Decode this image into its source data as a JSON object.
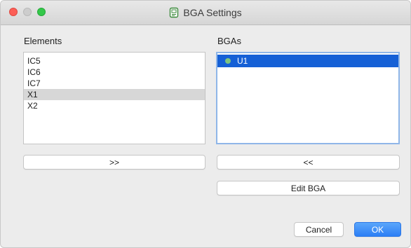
{
  "window": {
    "title": "BGA Settings",
    "icon": "chip-icon"
  },
  "elements_panel": {
    "label": "Elements",
    "items": [
      "IC5",
      "IC6",
      "IC7",
      "X1",
      "X2"
    ],
    "selected": "X1"
  },
  "bgas_panel": {
    "label": "BGAs",
    "items": [
      "U1"
    ],
    "selected": "U1",
    "status_color": "#7fc47f"
  },
  "buttons": {
    "add": ">>",
    "remove": "<<",
    "edit": "Edit BGA",
    "cancel": "Cancel",
    "ok": "OK"
  },
  "colors": {
    "selection_blue": "#1560d6",
    "primary_button": "#2c7ff5"
  }
}
